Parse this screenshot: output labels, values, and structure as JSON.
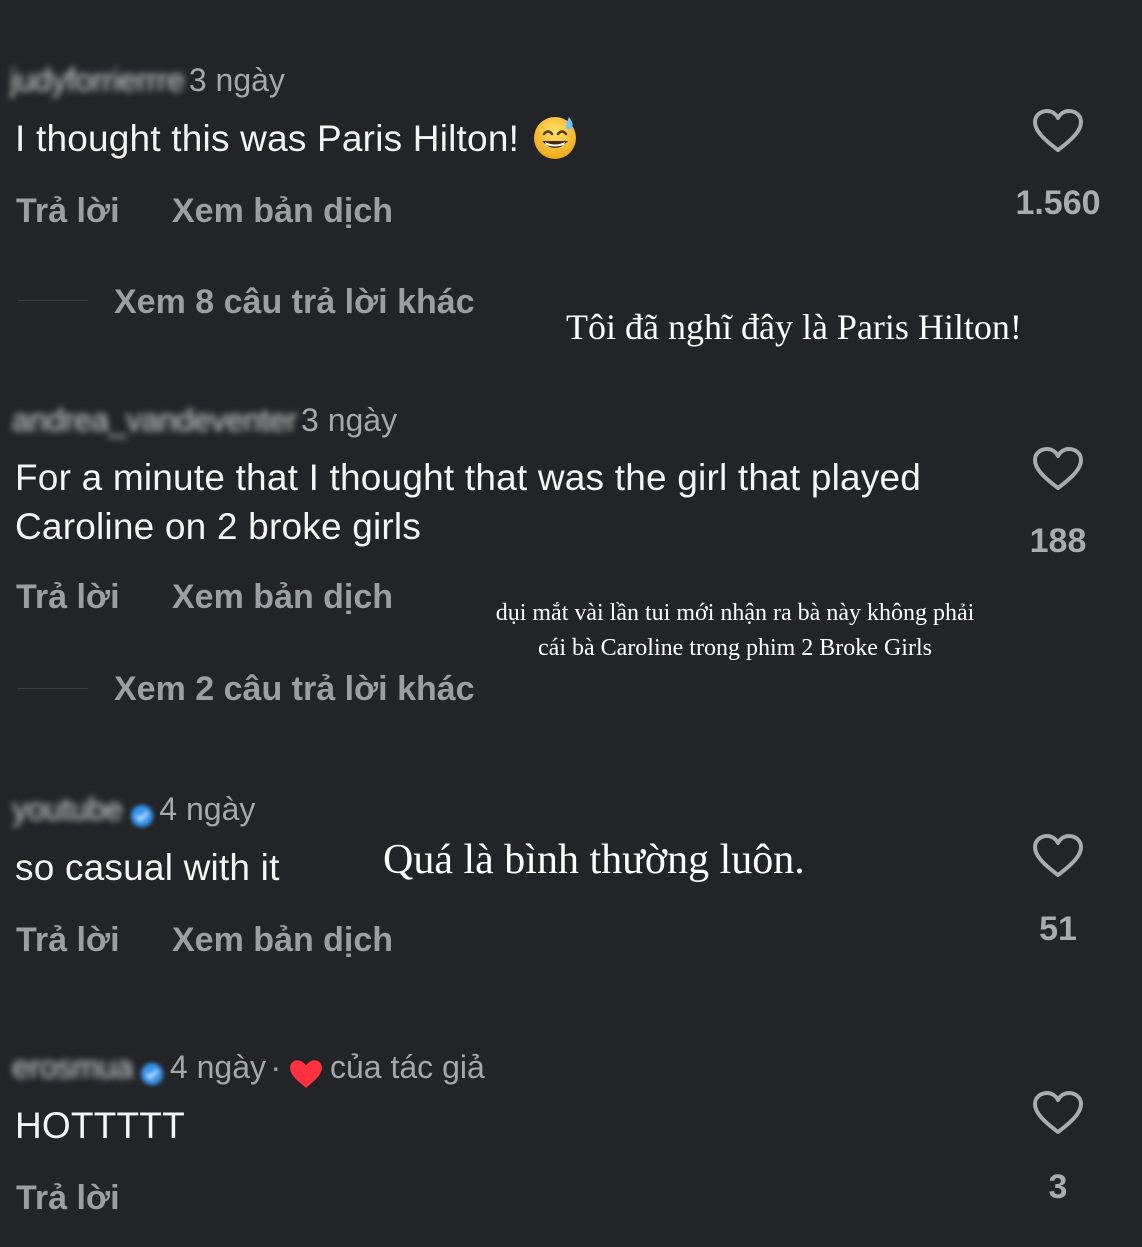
{
  "comments": [
    {
      "username": "judyforrierrre",
      "time": "3 ngày",
      "text": "I thought this was Paris Hilton!",
      "emoji": "sweat-smile-emoji",
      "reply_label": "Trả lời",
      "translate_label": "Xem bản dịch",
      "likes": "1.560",
      "more_replies": "Xem 8 câu trả lời khác",
      "overlay": "Tôi đã nghĩ đây là Paris Hilton!"
    },
    {
      "username": "andrea_vandeventer",
      "time": "3 ngày",
      "text": "For a minute that I thought that was the girl that played Caroline on 2 broke girls",
      "reply_label": "Trả lời",
      "translate_label": "Xem bản dịch",
      "likes": "188",
      "more_replies": "Xem 2 câu trả lời khác",
      "overlay_line1": "dụi mắt vài lần tui mới nhận ra bà này không phải",
      "overlay_line2": "cái bà Caroline trong phim 2 Broke Girls"
    },
    {
      "username": "youtube",
      "time": "4 ngày",
      "text": "so casual with it",
      "reply_label": "Trả lời",
      "translate_label": "Xem bản dịch",
      "likes": "51",
      "overlay": "Quá là bình thường luôn."
    },
    {
      "username": "erosmua",
      "time": "4 ngày",
      "separator": "·",
      "author_liked": "của tác giả",
      "text": "HOTTTTT",
      "reply_label": "Trả lời",
      "likes": "3"
    }
  ],
  "colors": {
    "background": "#222427",
    "verified": "#3897f0",
    "author_heart": "#ff3040"
  },
  "icons": [
    "heart-outline-icon",
    "verified-badge-icon",
    "red-heart-icon",
    "sweat-smile-emoji"
  ]
}
